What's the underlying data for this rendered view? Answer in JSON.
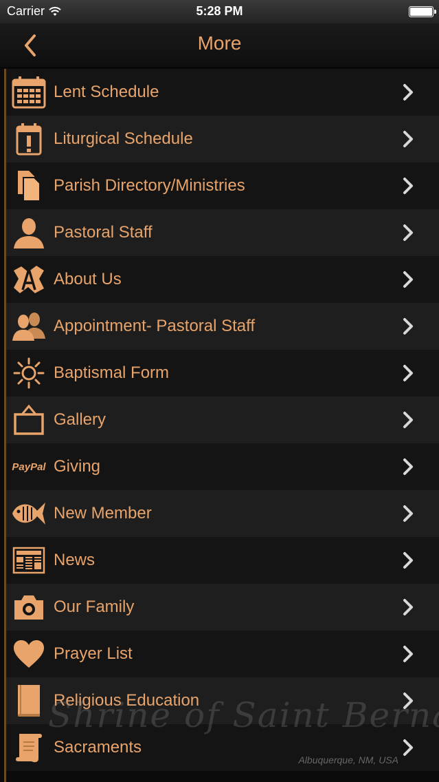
{
  "status_bar": {
    "carrier": "Carrier",
    "time": "5:28 PM"
  },
  "nav": {
    "title": "More"
  },
  "menu": [
    {
      "label": "Lent Schedule",
      "icon": "calendar-icon"
    },
    {
      "label": "Liturgical Schedule",
      "icon": "calendar-alert-icon"
    },
    {
      "label": "Parish Directory/Ministries",
      "icon": "documents-icon"
    },
    {
      "label": "Pastoral Staff",
      "icon": "person-icon"
    },
    {
      "label": "About Us",
      "icon": "about-icon"
    },
    {
      "label": "Appointment- Pastoral Staff",
      "icon": "people-icon"
    },
    {
      "label": "Baptismal Form",
      "icon": "sun-icon"
    },
    {
      "label": "Gallery",
      "icon": "frame-icon"
    },
    {
      "label": "Giving",
      "icon": "paypal-icon"
    },
    {
      "label": "New Member",
      "icon": "fish-icon"
    },
    {
      "label": "News",
      "icon": "newspaper-icon"
    },
    {
      "label": "Our Family",
      "icon": "camera-icon"
    },
    {
      "label": "Prayer List",
      "icon": "heart-icon"
    },
    {
      "label": "Religious Education",
      "icon": "book-icon"
    },
    {
      "label": "Sacraments",
      "icon": "scroll-icon"
    }
  ],
  "paypal_text": "PayPal",
  "watermark": {
    "title": "Shrine of Saint Bernadette",
    "location": "Albuquerque, NM, USA"
  },
  "colors": {
    "accent": "#e8a46b",
    "row_dark": "#141414",
    "row_light": "#1e1e1e"
  }
}
